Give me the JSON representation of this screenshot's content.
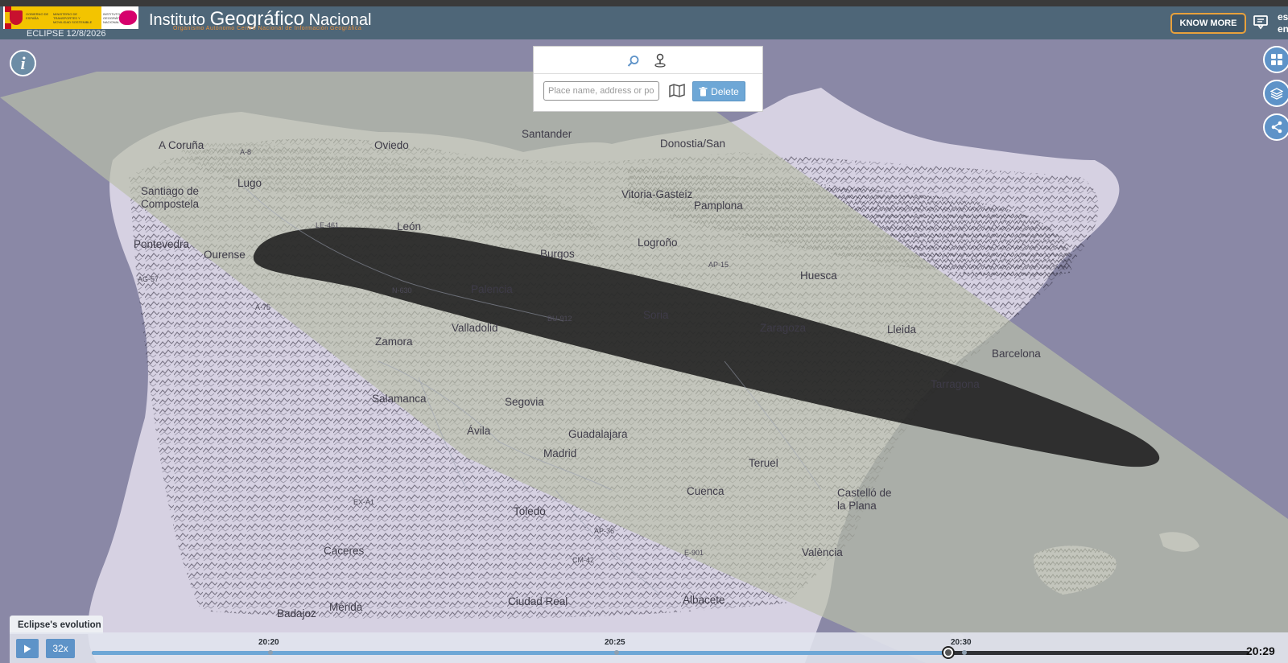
{
  "header": {
    "logo_text_1": "GOBIERNO DE ESPAÑA",
    "logo_text_2": "MINISTERIO DE TRANSPORTES Y MOVILIDAD SOSTENIBLE",
    "logo_text_3": "INSTITUTO GEOGRÁFICO NACIONAL",
    "title_pre": "Instituto ",
    "title_big": "Geográfico",
    "title_post": " Nacional",
    "subtitle": "Organismo Autónomo Centro Nacional de Información Geográfica",
    "eclipse_label": "ECLIPSE 12/8/2026",
    "know_more": "KNOW MORE",
    "lang_es": "es",
    "lang_en": "en"
  },
  "search": {
    "placeholder": "Place name, address or postal code",
    "delete_label": "Delete"
  },
  "map": {
    "cities": [
      "A Coruña",
      "Santiago de",
      "Compostela",
      "Lugo",
      "Pontevedra",
      "Ourense",
      "León",
      "Santander",
      "Donostia/San",
      "Burgos",
      "Logroño",
      "Palencia",
      "Valladolid",
      "Zamora",
      "Soria",
      "Huesca",
      "Zaragoza",
      "Lleida",
      "Salamanca",
      "Segovia",
      "Ávila",
      "Guadalajara",
      "Madrid",
      "Teruel",
      "Cuenca",
      "Toledo",
      "Castelló de la Plana",
      "València",
      "Cáceres",
      "Mérida",
      "Badajoz",
      "Ciudad Real",
      "Albacete",
      "Tarragona",
      "Barcelona",
      "Vitoria-Gasteiz",
      "Pamplona",
      "Oviedo"
    ],
    "roads": [
      "A-8",
      "AG-57",
      "A-75",
      "LE-461",
      "N-630",
      "BU-912",
      "AP-15",
      "EX-A1",
      "AP-36",
      "CM-42",
      "E-901"
    ],
    "colors": {
      "eclipse_path": "#1e1e1e",
      "totality_band": "#c9cfb8",
      "land": "#d8d3e3",
      "sea": "#8a8aa6"
    }
  },
  "timeline": {
    "tab_label": "Eclipse's evolution",
    "speed": "32x",
    "ticks": [
      "20:20",
      "20:25",
      "20:30"
    ],
    "current_time": "20:29",
    "progress": 0.74
  }
}
